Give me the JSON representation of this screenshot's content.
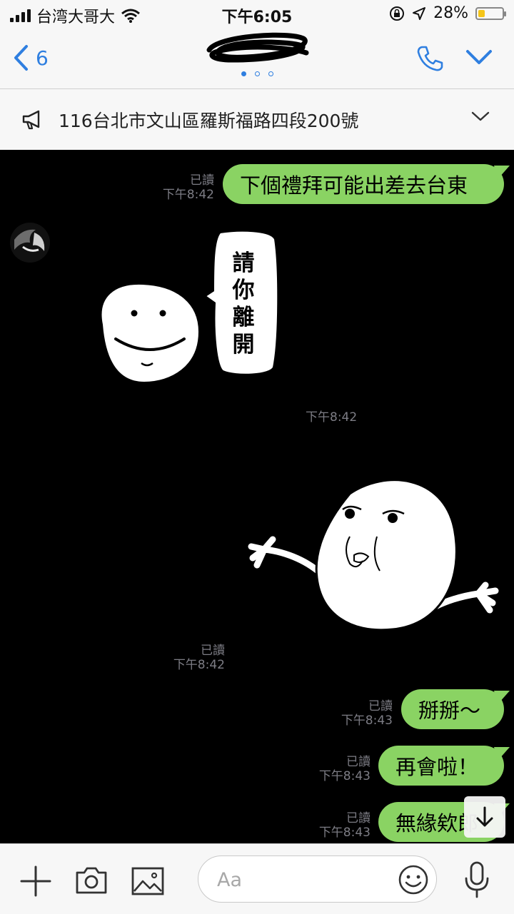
{
  "status": {
    "carrier": "台湾大哥大",
    "time": "下午6:05",
    "battery": "28%",
    "battery_level": 0.28
  },
  "nav": {
    "back_count": "6",
    "page_dots": 3,
    "active_dot": 0
  },
  "announcement": {
    "text": "116台北市文山區羅斯福路四段200號"
  },
  "messages": [
    {
      "side": "right",
      "type": "text",
      "text": "下個禮拜可能出差去台東",
      "read": "已讀",
      "time": "下午8:42"
    },
    {
      "side": "left",
      "type": "sticker",
      "sticker": "smiley-please-leave-sticker",
      "sticker_text": [
        "請",
        "你",
        "離",
        "開"
      ],
      "time": "下午8:42"
    },
    {
      "side": "right",
      "type": "sticker",
      "sticker": "shrugging-blob-sticker",
      "read": "已讀",
      "time": "下午8:42"
    },
    {
      "side": "right",
      "type": "text",
      "text": "掰掰～",
      "read": "已讀",
      "time": "下午8:43"
    },
    {
      "side": "right",
      "type": "text",
      "text": "再會啦！",
      "read": "已讀",
      "time": "下午8:43"
    },
    {
      "side": "right",
      "type": "text",
      "text": "無緣欸郎",
      "read": "已讀",
      "time": "下午8:43"
    }
  ],
  "input": {
    "placeholder": "Aa"
  },
  "colors": {
    "accent": "#2f7fe0",
    "bubble_green": "#8ad363",
    "chat_background": "#000000",
    "meta_text": "#7d7d85"
  }
}
